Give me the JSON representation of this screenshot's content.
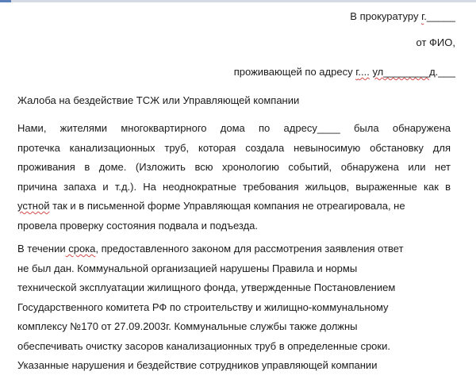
{
  "header": {
    "to_prefix": "В прокуратуру ",
    "to_g": "г",
    "to_suffix": "._____",
    "from": "от ФИО,",
    "address_prefix": "проживающей по адресу ",
    "address_g": "г",
    "address_dots": "....",
    "address_ul": "ул",
    "address_blank": "________",
    "address_d": "д.",
    "address_end": "___"
  },
  "title": "Жалоба на бездействие ТСЖ или Управляющей компании",
  "paragraph1": {
    "lines": [
      "Нами, жителями многоквартирного дома по адресу____ была обнаружена",
      "протечка канализационных труб, которая создала невыносимую обстановку для",
      "проживания в доме. (Изложить всю хронологию событий, обнаружена или нет",
      "причина запаха и т.д.). На неоднократные требования жильцов, выраженные как в"
    ],
    "line5_squiggle": "устной",
    "line5_rest": " так и в письменной форме Управляющая компания не отреагировала, не",
    "line6": "провела проверку состояния подвала и подъезда."
  },
  "paragraph2": {
    "line1_a": "В течении",
    "line1_squiggle": " срока",
    "line1_b": ", предоставленного законом для рассмотрения заявления ответ",
    "lines": [
      "не был дан. Коммунальной организацией нарушены Правила и нормы",
      "технической эксплуатации жилищного фонда, утвержденные Постановлением",
      "Государственного комитета РФ по строительству и жилищно-коммунальному",
      "комплексу №170 от 27.09.2003г. Коммунальные службы также должны",
      "обеспечивать очистку засоров канализационных труб в определенные сроки.",
      "Указанные нарушения и бездействие сотрудников управляющей компании"
    ]
  }
}
